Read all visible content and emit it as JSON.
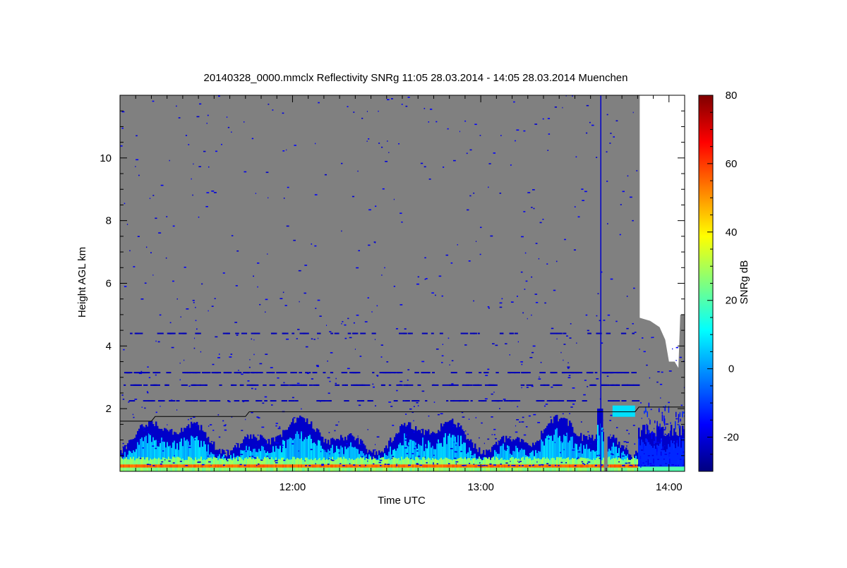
{
  "chart_data": {
    "type": "heatmap",
    "title": "20140328_0000.mmclx Reflectivity SNRg   11:05 28.03.2014 - 14:05 28.03.2014 Muenchen",
    "xlabel": "Time UTC",
    "ylabel": "Height AGL km",
    "x_range": [
      "11:05",
      "14:05"
    ],
    "xlim_hours": [
      11.0833,
      14.0833
    ],
    "ylim_km": [
      0,
      12
    ],
    "x_ticks": [
      {
        "label": "12:00",
        "value": 12.0
      },
      {
        "label": "13:00",
        "value": 13.0
      },
      {
        "label": "14:00",
        "value": 14.0
      }
    ],
    "y_ticks": [
      {
        "label": "2",
        "value": 2
      },
      {
        "label": "4",
        "value": 4
      },
      {
        "label": "6",
        "value": 6
      },
      {
        "label": "8",
        "value": 8
      },
      {
        "label": "10",
        "value": 10
      }
    ],
    "colorbar": {
      "label": "SNRg dB",
      "range": [
        -30,
        80
      ],
      "ticks": [
        {
          "label": "-20",
          "value": -20
        },
        {
          "label": "0",
          "value": 0
        },
        {
          "label": "20",
          "value": 20
        },
        {
          "label": "40",
          "value": 40
        },
        {
          "label": "60",
          "value": 60
        },
        {
          "label": "80",
          "value": 80
        }
      ],
      "colormap": [
        "#00007f",
        "#0000ff",
        "#007fff",
        "#00ffff",
        "#7fff7f",
        "#ffff00",
        "#ff7f00",
        "#ff0000",
        "#7f0000"
      ]
    },
    "background_color": "#808080",
    "missing_color": "#ffffff",
    "boundary_line_km": [
      {
        "t": 11.0833,
        "h": 1.6
      },
      {
        "t": 11.25,
        "h": 1.6
      },
      {
        "t": 11.27,
        "h": 1.75
      },
      {
        "t": 11.75,
        "h": 1.75
      },
      {
        "t": 11.77,
        "h": 1.9
      },
      {
        "t": 13.82,
        "h": 1.9
      },
      {
        "t": 13.84,
        "h": 2.05
      },
      {
        "t": 14.0833,
        "h": 2.05
      }
    ],
    "data_gap_start": "13:50"
  }
}
